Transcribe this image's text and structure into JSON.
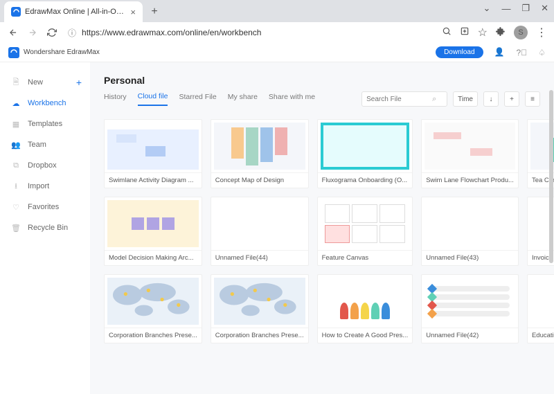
{
  "browser": {
    "tab_title": "EdrawMax Online | All-in-One Diag",
    "url": "https://www.edrawmax.com/online/en/workbench",
    "profile_initial": "S"
  },
  "header": {
    "brand": "Wondershare EdrawMax",
    "download": "Download"
  },
  "sidebar": {
    "items": [
      {
        "label": "New",
        "icon": "file-plus",
        "has_add": true
      },
      {
        "label": "Workbench",
        "icon": "cloud",
        "active": true
      },
      {
        "label": "Templates",
        "icon": "grid"
      },
      {
        "label": "Team",
        "icon": "users"
      },
      {
        "label": "Dropbox",
        "icon": "dropbox"
      },
      {
        "label": "Import",
        "icon": "import"
      },
      {
        "label": "Favorites",
        "icon": "heart"
      },
      {
        "label": "Recycle Bin",
        "icon": "trash"
      }
    ]
  },
  "main": {
    "title": "Personal",
    "tabs": [
      {
        "label": "History"
      },
      {
        "label": "Cloud file",
        "active": true
      },
      {
        "label": "Starred File"
      },
      {
        "label": "My share"
      },
      {
        "label": "Share with me"
      }
    ],
    "search_placeholder": "Search File",
    "sort_label": "Time",
    "files": [
      {
        "title": "Swimlane Activity Diagram ...",
        "thumb": "swim"
      },
      {
        "title": "Concept Map of Design",
        "thumb": "concept"
      },
      {
        "title": "Fluxograma Onboarding (O...",
        "thumb": "flux"
      },
      {
        "title": "Swim Lane Flowchart Produ...",
        "thumb": "lane"
      },
      {
        "title": "Tea Company Business Can...",
        "thumb": "tea"
      },
      {
        "title": "Model Decision Making Arc...",
        "thumb": "model"
      },
      {
        "title": "Unnamed File(44)",
        "thumb": "blank"
      },
      {
        "title": "Feature Canvas",
        "thumb": "feat"
      },
      {
        "title": "Unnamed File(43)",
        "thumb": "blank"
      },
      {
        "title": "Invoice Quotation",
        "thumb": "inv"
      },
      {
        "title": "Corporation Branches Prese...",
        "thumb": "map"
      },
      {
        "title": "Corporation Branches Prese...",
        "thumb": "map"
      },
      {
        "title": "How to Create A Good Pres...",
        "thumb": "pres"
      },
      {
        "title": "Unnamed File(42)",
        "thumb": "chips"
      },
      {
        "title": "Education Infographic",
        "thumb": "edu"
      }
    ]
  }
}
